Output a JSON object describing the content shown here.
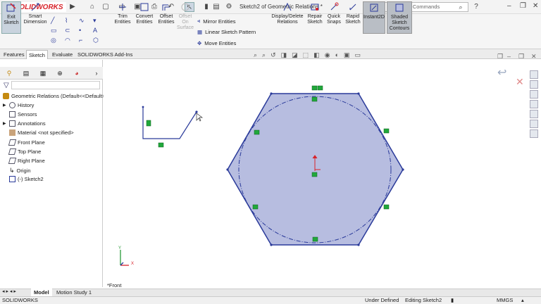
{
  "app": {
    "brand": "SOLIDWORKS",
    "doc_title": "Sketch2 of Geometric Relations *"
  },
  "search": {
    "placeholder": "Search Commands"
  },
  "ribbon": {
    "exit_sketch": "Exit Sketch",
    "smart_dimension": "Smart Dimension",
    "trim": "Trim Entities",
    "convert": "Convert Entities",
    "offset": "Offset Entities",
    "offset_surface": "Offset On Surface",
    "mirror": "Mirror Entities",
    "linear_pattern": "Linear Sketch Pattern",
    "move": "Move Entities",
    "display_relations": "Display/Delete Relations",
    "repair": "Repair Sketch",
    "quick_snaps": "Quick Snaps",
    "rapid_sketch": "Rapid Sketch",
    "instant2d": "Instant2D",
    "shaded_contours": "Shaded Sketch Contours"
  },
  "tabs": [
    "Features",
    "Sketch",
    "Evaluate",
    "SOLIDWORKS Add-Ins"
  ],
  "tree": {
    "root": "Geometric Relations  (Default<<Default>",
    "items": [
      "History",
      "Sensors",
      "Annotations",
      "Material <not specified>",
      "Front Plane",
      "Top Plane",
      "Right Plane",
      "Origin",
      "(-) Sketch2"
    ]
  },
  "canvas": {
    "view_label": "*Front",
    "axis_y": "Y",
    "axis_x": "X"
  },
  "bottom_tabs": [
    "Model",
    "Motion Study 1"
  ],
  "status": {
    "app": "SOLIDWORKS",
    "state": "Under Defined",
    "editing": "Editing Sketch2",
    "units": "MMGS"
  },
  "colors": {
    "sketch_line": "#2a3a9a",
    "fill": "#b7bde0",
    "relation": "#21a83b",
    "brand": "#d8232a"
  }
}
